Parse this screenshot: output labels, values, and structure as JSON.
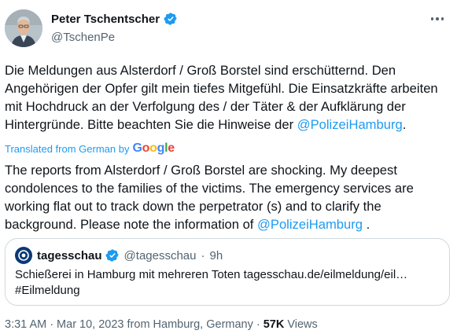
{
  "author": {
    "display_name": "Peter Tschentscher",
    "handle": "@TschenPe"
  },
  "tweet": {
    "text_part1": "Die Meldungen aus Alsterdorf / Groß Borstel sind erschütternd. Den Angehörigen der Opfer gilt mein tiefes Mitgefühl. Die Einsatzkräfte arbeiten mit Hochdruck an der Verfolgung des / der Täter & der Aufklärung der Hintergründe. Bitte beachten Sie die Hinweise der ",
    "mention": "@PolizeiHamburg",
    "text_part2": "."
  },
  "translation": {
    "label": "Translated from German by",
    "provider": "Google",
    "text_part1": "The reports from Alsterdorf / Groß Borstel are shocking. My deepest condolences to the families of the victims. The emergency services are working flat out to track down the perpetrator (s) and to clarify the background. Please note the information of ",
    "mention": "@PolizeiHamburg",
    "text_part2": " ."
  },
  "quote": {
    "name": "tagesschau",
    "handle": "@tagesschau",
    "separator": "·",
    "time": "9h",
    "line1": "Schießerei in Hamburg mit mehreren Toten tagesschau.de/eilmeldung/eil…",
    "line2": "#Eilmeldung"
  },
  "meta": {
    "time": "3:31 AM",
    "dot1": "·",
    "date": "Mar 10, 2023 from Hamburg, Germany",
    "dot2": "·",
    "views_count": "57K",
    "views_label": "Views"
  },
  "icons": {
    "verified": "verified-badge-icon",
    "more": "more-options-icon"
  },
  "colors": {
    "accent": "#1d9bf0",
    "text": "#0f1419",
    "secondary": "#536471",
    "border": "#cfd9de"
  }
}
